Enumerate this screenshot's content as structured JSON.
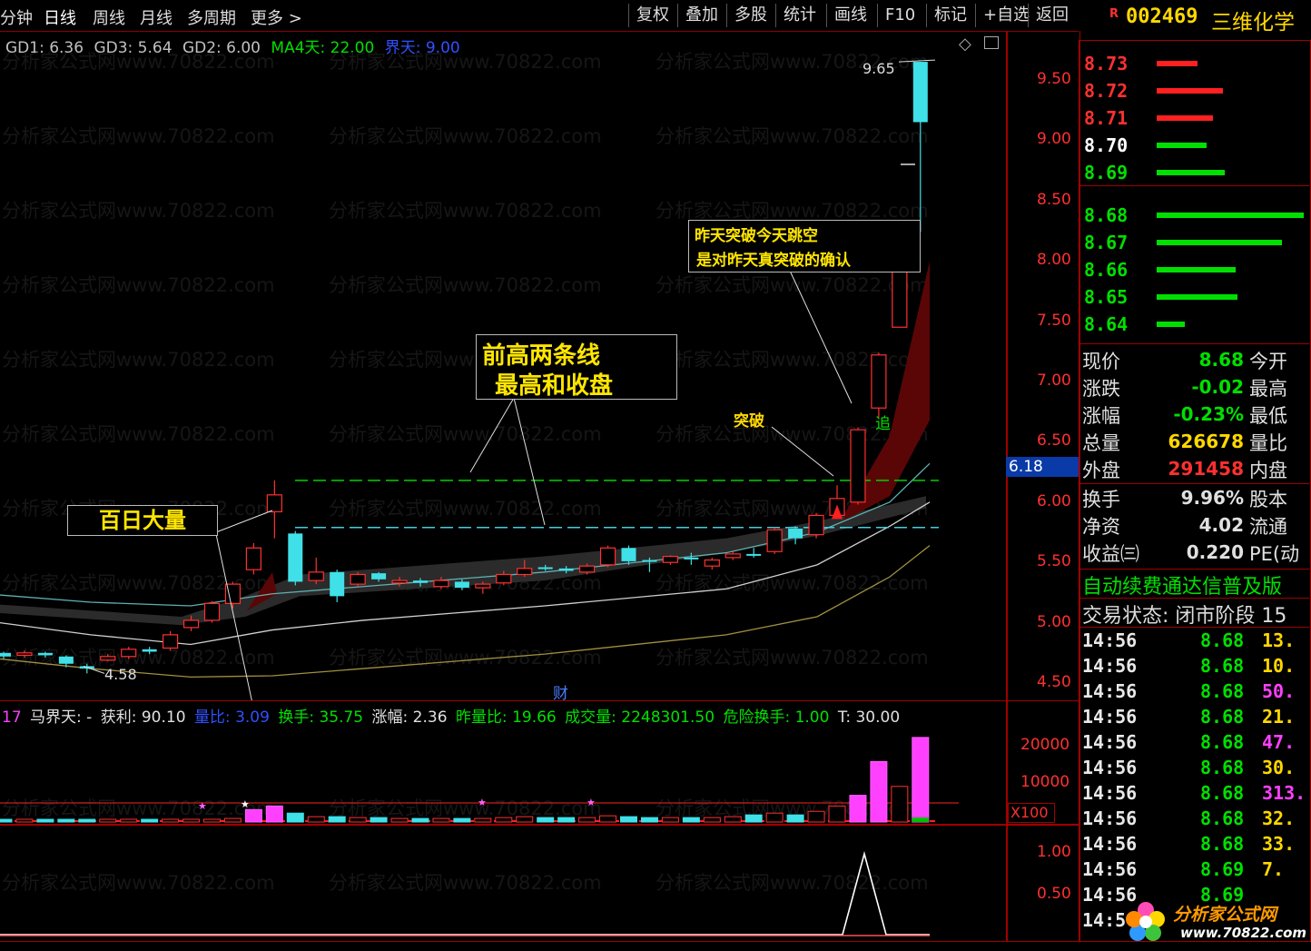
{
  "toolbar": {
    "left_items": [
      "分钟",
      "日线",
      "周线",
      "月线",
      "多周期",
      "更多 >"
    ],
    "active": "日线",
    "right_items": [
      "复权",
      "叠加",
      "多股",
      "统计",
      "画线",
      "F10",
      "标记",
      "+自选",
      "返回"
    ]
  },
  "stock": {
    "marker": "R",
    "code": "002469",
    "name": "三维化学"
  },
  "indicator_bar": {
    "items": [
      {
        "text": "GD1: 6.36",
        "color": "#c0c0c0"
      },
      {
        "text": "GD3: 5.64",
        "color": "#c0c0c0"
      },
      {
        "text": "GD2: 6.00",
        "color": "#c0c0c0"
      },
      {
        "text": "MA4天: 22.00",
        "color": "#00e000"
      },
      {
        "text": "界天: 9.00",
        "color": "#3050ff"
      }
    ]
  },
  "watermark": "分析家公式网www.70822.com",
  "price_axis": [
    "9.50",
    "9.00",
    "8.50",
    "8.00",
    "7.50",
    "7.00",
    "6.50",
    "6.00",
    "5.50",
    "5.00",
    "4.50"
  ],
  "current_price_tag": "6.18",
  "chart_labels": {
    "high": "9.65",
    "low": "4.58",
    "cai": "财",
    "zhui": "追"
  },
  "annotations": {
    "baiyi": "百日大量",
    "qiangao_line1": "前高两条线",
    "qiangao_line2": "最高和收盘",
    "tupo": "突破",
    "confirm_line1": "昨天突破今天跳空",
    "confirm_line2": "是对昨天真突破的确认"
  },
  "volume_bar": {
    "items": [
      {
        "text": "17",
        "color": "#ff40ff"
      },
      {
        "text": "马界天: -",
        "color": "#e0e0e0"
      },
      {
        "text": "获利: 90.10",
        "color": "#e0e0e0"
      },
      {
        "text": "量比: 3.09",
        "color": "#3050ff"
      },
      {
        "text": "换手: 35.75",
        "color": "#00e000"
      },
      {
        "text": "涨幅: 2.36",
        "color": "#e0e0e0"
      },
      {
        "text": "昨量比: 19.66",
        "color": "#00e000"
      },
      {
        "text": "成交量: 2248301.50",
        "color": "#00e000"
      },
      {
        "text": "危险换手: 1.00",
        "color": "#00e000"
      },
      {
        "text": "T: 30.00",
        "color": "#e0e0e0"
      }
    ]
  },
  "volume_axis": [
    "20000",
    "10000"
  ],
  "volume_unit": "X100",
  "lower_axis": [
    "1.00",
    "0.50"
  ],
  "order_book": [
    {
      "price": "8.73",
      "color": "#ff3030",
      "bar": 0.28,
      "bar_color": "#ff2020"
    },
    {
      "price": "8.72",
      "color": "#ff3030",
      "bar": 0.45,
      "bar_color": "#ff2020"
    },
    {
      "price": "8.71",
      "color": "#ff3030",
      "bar": 0.38,
      "bar_color": "#ff2020"
    },
    {
      "price": "8.70",
      "color": "#ffffff",
      "bar": 0.34,
      "bar_color": "#00e000"
    },
    {
      "price": "8.69",
      "color": "#00e000",
      "bar": 0.46,
      "bar_color": "#00e000"
    },
    {
      "price": "8.68",
      "color": "#00e000",
      "bar": 1.0,
      "bar_color": "#00e000"
    },
    {
      "price": "8.67",
      "color": "#00e000",
      "bar": 0.85,
      "bar_color": "#00e000"
    },
    {
      "price": "8.66",
      "color": "#00e000",
      "bar": 0.54,
      "bar_color": "#00e000"
    },
    {
      "price": "8.65",
      "color": "#00e000",
      "bar": 0.55,
      "bar_color": "#00e000"
    },
    {
      "price": "8.64",
      "color": "#00e000",
      "bar": 0.19,
      "bar_color": "#00e000"
    }
  ],
  "quote": [
    {
      "label": "现价",
      "value": "8.68",
      "vcolor": "#00e000",
      "tail": "今开"
    },
    {
      "label": "涨跌",
      "value": "-0.02",
      "vcolor": "#00e000",
      "tail": "最高"
    },
    {
      "label": "涨幅",
      "value": "-0.23%",
      "vcolor": "#00e000",
      "tail": "最低"
    },
    {
      "label": "总量",
      "value": "626678",
      "vcolor": "#ffd800",
      "tail": "量比"
    },
    {
      "label": "外盘",
      "value": "291458",
      "vcolor": "#ff3030",
      "tail": "内盘"
    }
  ],
  "fundamentals": [
    {
      "label": "换手",
      "value": "9.96%",
      "tail": "股本"
    },
    {
      "label": "净资",
      "value": "4.02",
      "tail": "流通"
    },
    {
      "label": "收益㈢",
      "value": "0.220",
      "tail": "PE(动"
    }
  ],
  "scroll_text": "自动续费通达信普及版",
  "trade_status": "交易状态: 闭市阶段 15",
  "ticks": [
    {
      "time": "14:56",
      "price": "8.68",
      "vol": "13.",
      "vcolor": "#ffd800"
    },
    {
      "time": "14:56",
      "price": "8.68",
      "vol": "10.",
      "vcolor": "#ffd800"
    },
    {
      "time": "14:56",
      "price": "8.68",
      "vol": "50.",
      "vcolor": "#ff40ff"
    },
    {
      "time": "14:56",
      "price": "8.68",
      "vol": "21.",
      "vcolor": "#ffd800"
    },
    {
      "time": "14:56",
      "price": "8.68",
      "vol": "47.",
      "vcolor": "#ff40ff"
    },
    {
      "time": "14:56",
      "price": "8.68",
      "vol": "30.",
      "vcolor": "#ffd800"
    },
    {
      "time": "14:56",
      "price": "8.68",
      "vol": "313.",
      "vcolor": "#ff40ff"
    },
    {
      "time": "14:56",
      "price": "8.68",
      "vol": "32.",
      "vcolor": "#ffd800"
    },
    {
      "time": "14:56",
      "price": "8.68",
      "vol": "33.",
      "vcolor": "#ffd800"
    },
    {
      "time": "14:56",
      "price": "8.69",
      "vol": "7.",
      "vcolor": "#ffd800"
    },
    {
      "time": "14:56",
      "price": "8.69",
      "vol": "",
      "vcolor": "#ffd800"
    },
    {
      "time": "14:5",
      "price": "",
      "vol": "",
      "vcolor": "#ffd800"
    }
  ],
  "logo": {
    "title": "分析家公式网",
    "url": "www.70822.com"
  },
  "chart_data": {
    "type": "candlestick",
    "y_axis_labels": [
      "9.50",
      "9.00",
      "8.50",
      "8.00",
      "7.50",
      "7.00",
      "6.50",
      "6.00",
      "5.50",
      "5.00",
      "4.50"
    ],
    "candles": [
      {
        "o": 4.75,
        "c": 4.72,
        "h": 4.76,
        "l": 4.7
      },
      {
        "o": 4.73,
        "c": 4.75,
        "h": 4.77,
        "l": 4.71
      },
      {
        "o": 4.75,
        "c": 4.73,
        "h": 4.76,
        "l": 4.71
      },
      {
        "o": 4.72,
        "c": 4.66,
        "h": 4.73,
        "l": 4.63
      },
      {
        "o": 4.64,
        "c": 4.62,
        "h": 4.66,
        "l": 4.58
      },
      {
        "o": 4.69,
        "c": 4.72,
        "h": 4.74,
        "l": 4.68
      },
      {
        "o": 4.72,
        "c": 4.78,
        "h": 4.8,
        "l": 4.7
      },
      {
        "o": 4.78,
        "c": 4.76,
        "h": 4.8,
        "l": 4.74
      },
      {
        "o": 4.79,
        "c": 4.9,
        "h": 4.93,
        "l": 4.77
      },
      {
        "o": 4.96,
        "c": 5.02,
        "h": 5.06,
        "l": 4.93
      },
      {
        "o": 5.02,
        "c": 5.16,
        "h": 5.18,
        "l": 5.0
      },
      {
        "o": 5.16,
        "c": 5.32,
        "h": 5.34,
        "l": 5.12
      },
      {
        "o": 5.44,
        "c": 5.62,
        "h": 5.66,
        "l": 5.4
      },
      {
        "o": 5.92,
        "c": 6.06,
        "h": 6.18,
        "l": 5.7
      },
      {
        "o": 5.74,
        "c": 5.34,
        "h": 5.76,
        "l": 5.31
      },
      {
        "o": 5.35,
        "c": 5.42,
        "h": 5.54,
        "l": 5.32
      },
      {
        "o": 5.42,
        "c": 5.22,
        "h": 5.44,
        "l": 5.17
      },
      {
        "o": 5.32,
        "c": 5.4,
        "h": 5.42,
        "l": 5.3
      },
      {
        "o": 5.41,
        "c": 5.36,
        "h": 5.42,
        "l": 5.34
      },
      {
        "o": 5.33,
        "c": 5.35,
        "h": 5.38,
        "l": 5.3
      },
      {
        "o": 5.35,
        "c": 5.33,
        "h": 5.37,
        "l": 5.3
      },
      {
        "o": 5.3,
        "c": 5.35,
        "h": 5.38,
        "l": 5.28
      },
      {
        "o": 5.34,
        "c": 5.29,
        "h": 5.36,
        "l": 5.27
      },
      {
        "o": 5.29,
        "c": 5.32,
        "h": 5.34,
        "l": 5.24
      },
      {
        "o": 5.33,
        "c": 5.4,
        "h": 5.43,
        "l": 5.31
      },
      {
        "o": 5.4,
        "c": 5.45,
        "h": 5.52,
        "l": 5.38
      },
      {
        "o": 5.46,
        "c": 5.45,
        "h": 5.48,
        "l": 5.43
      },
      {
        "o": 5.45,
        "c": 5.43,
        "h": 5.47,
        "l": 5.41
      },
      {
        "o": 5.42,
        "c": 5.47,
        "h": 5.49,
        "l": 5.4
      },
      {
        "o": 5.48,
        "c": 5.62,
        "h": 5.64,
        "l": 5.46
      },
      {
        "o": 5.62,
        "c": 5.51,
        "h": 5.64,
        "l": 5.48
      },
      {
        "o": 5.52,
        "c": 5.51,
        "h": 5.54,
        "l": 5.42
      },
      {
        "o": 5.5,
        "c": 5.55,
        "h": 5.56,
        "l": 5.48
      },
      {
        "o": 5.54,
        "c": 5.53,
        "h": 5.58,
        "l": 5.48
      },
      {
        "o": 5.47,
        "c": 5.52,
        "h": 5.54,
        "l": 5.44
      },
      {
        "o": 5.54,
        "c": 5.57,
        "h": 5.59,
        "l": 5.52
      },
      {
        "o": 5.57,
        "c": 5.56,
        "h": 5.62,
        "l": 5.54
      },
      {
        "o": 5.59,
        "c": 5.77,
        "h": 5.79,
        "l": 5.57
      },
      {
        "o": 5.78,
        "c": 5.7,
        "h": 5.8,
        "l": 5.65
      },
      {
        "o": 5.73,
        "c": 5.89,
        "h": 5.91,
        "l": 5.7
      },
      {
        "o": 5.89,
        "c": 6.03,
        "h": 6.14,
        "l": 5.87
      },
      {
        "o": 6.0,
        "c": 6.6,
        "h": 6.62,
        "l": 5.98
      },
      {
        "o": 6.78,
        "c": 7.22,
        "h": 7.24,
        "l": 6.7
      },
      {
        "o": 7.45,
        "c": 7.96,
        "h": 8.0,
        "l": 7.45
      },
      {
        "o": 9.65,
        "c": 9.15,
        "h": 9.65,
        "l": 8.24
      }
    ]
  }
}
